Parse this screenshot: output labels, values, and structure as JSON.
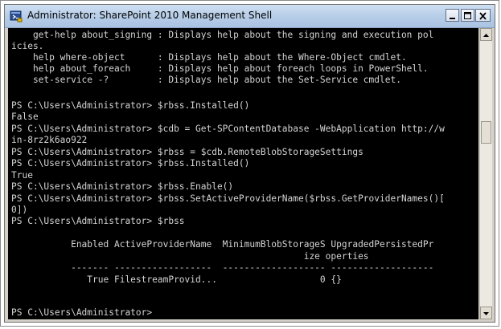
{
  "window": {
    "title": "Administrator: SharePoint 2010 Management Shell",
    "icon": "powershell-icon",
    "controls": {
      "minimize": "minimize-icon",
      "maximize": "maximize-icon",
      "close": "close-icon"
    }
  },
  "console": {
    "lines": [
      "    get-help about_signing : Displays help about the signing and execution pol",
      "icies.",
      "    help where-object      : Displays help about the Where-Object cmdlet.",
      "    help about_foreach     : Displays help about foreach loops in PowerShell.",
      "    set-service -?         : Displays help about the Set-Service cmdlet.",
      "",
      "",
      "PS C:\\Users\\Administrator> $rbss.Installed()",
      "False",
      "PS C:\\Users\\Administrator> $cdb = Get-SPContentDatabase -WebApplication http://w",
      "in-8rz2k6ao922",
      "PS C:\\Users\\Administrator> $rbss = $cdb.RemoteBlobStorageSettings",
      "PS C:\\Users\\Administrator> $rbss.Installed()",
      "True",
      "PS C:\\Users\\Administrator> $rbss.Enable()",
      "PS C:\\Users\\Administrator> $rbss.SetActiveProviderName($rbss.GetProviderNames()[",
      "0])",
      "PS C:\\Users\\Administrator> $rbss",
      "",
      "",
      "           Enabled ActiveProviderName  MinimumBlobStorageS UpgradedPersistedPr",
      "                                                      ize operties",
      "           ------- ------------------  ------------------- -------------------",
      "              True FilestreamProvid...                   0 {}",
      "",
      "",
      "PS C:\\Users\\Administrator>"
    ]
  },
  "scrollbar": {
    "up_icon": "arrow-up-icon",
    "down_icon": "arrow-down-icon",
    "thumb_position": 0.33
  }
}
